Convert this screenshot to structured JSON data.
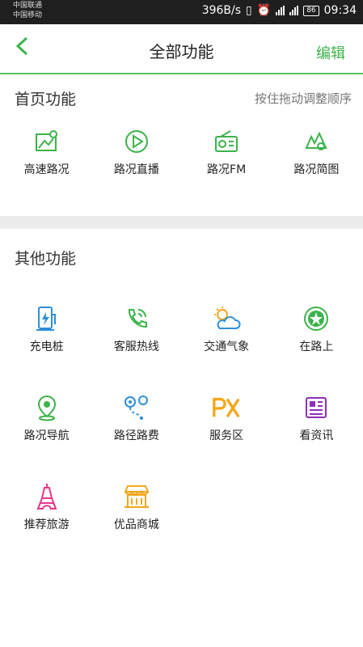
{
  "status_bar": {
    "carrier_1": "中国联通",
    "carrier_2": "中国移动",
    "net_speed": "396B/s",
    "battery": "86",
    "time": "09:34"
  },
  "header": {
    "title": "全部功能",
    "edit_label": "编辑"
  },
  "home_section": {
    "title": "首页功能",
    "hint": "按住拖动调整顺序",
    "items": [
      {
        "label": "高速路况",
        "icon": "highway-map-icon"
      },
      {
        "label": "路况直播",
        "icon": "play-icon"
      },
      {
        "label": "路况FM",
        "icon": "radio-icon"
      },
      {
        "label": "路况简图",
        "icon": "simple-map-icon"
      }
    ]
  },
  "other_section": {
    "title": "其他功能",
    "items": [
      {
        "label": "充电桩",
        "icon": "charging-pile-icon"
      },
      {
        "label": "客服热线",
        "icon": "phone-icon"
      },
      {
        "label": "交通气象",
        "icon": "weather-icon"
      },
      {
        "label": "在路上",
        "icon": "star-badge-icon"
      },
      {
        "label": "路况导航",
        "icon": "navigation-pin-icon"
      },
      {
        "label": "路径路费",
        "icon": "route-fee-icon"
      },
      {
        "label": "服务区",
        "icon": "px-service-icon"
      },
      {
        "label": "看资讯",
        "icon": "news-icon"
      },
      {
        "label": "推荐旅游",
        "icon": "tower-icon"
      },
      {
        "label": "优品商城",
        "icon": "shop-icon"
      }
    ]
  },
  "colors": {
    "accent": "#3cb34a",
    "divider": "#ececec"
  }
}
